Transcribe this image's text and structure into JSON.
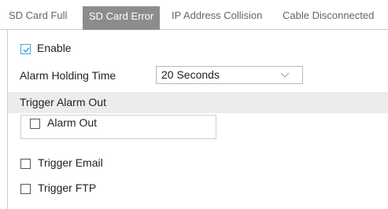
{
  "tabs": [
    {
      "label": "SD Card Full",
      "active": false
    },
    {
      "label": "SD Card Error",
      "active": true
    },
    {
      "label": "IP Address Collision",
      "active": false
    },
    {
      "label": "Cable Disconnected",
      "active": false
    }
  ],
  "enable": {
    "label": "Enable",
    "checked": true
  },
  "alarm_holding_time": {
    "label": "Alarm Holding Time",
    "value": "20 Seconds"
  },
  "trigger_alarm_out": {
    "title": "Trigger Alarm Out",
    "alarm_out_label": "Alarm Out",
    "alarm_out_checked": false
  },
  "trigger_email": {
    "label": "Trigger Email",
    "checked": false
  },
  "trigger_ftp": {
    "label": "Trigger FTP",
    "checked": false
  },
  "colors": {
    "accent": "#4aa3df",
    "active_tab_bg": "#8c8c8c",
    "section_bg": "#ececec"
  }
}
